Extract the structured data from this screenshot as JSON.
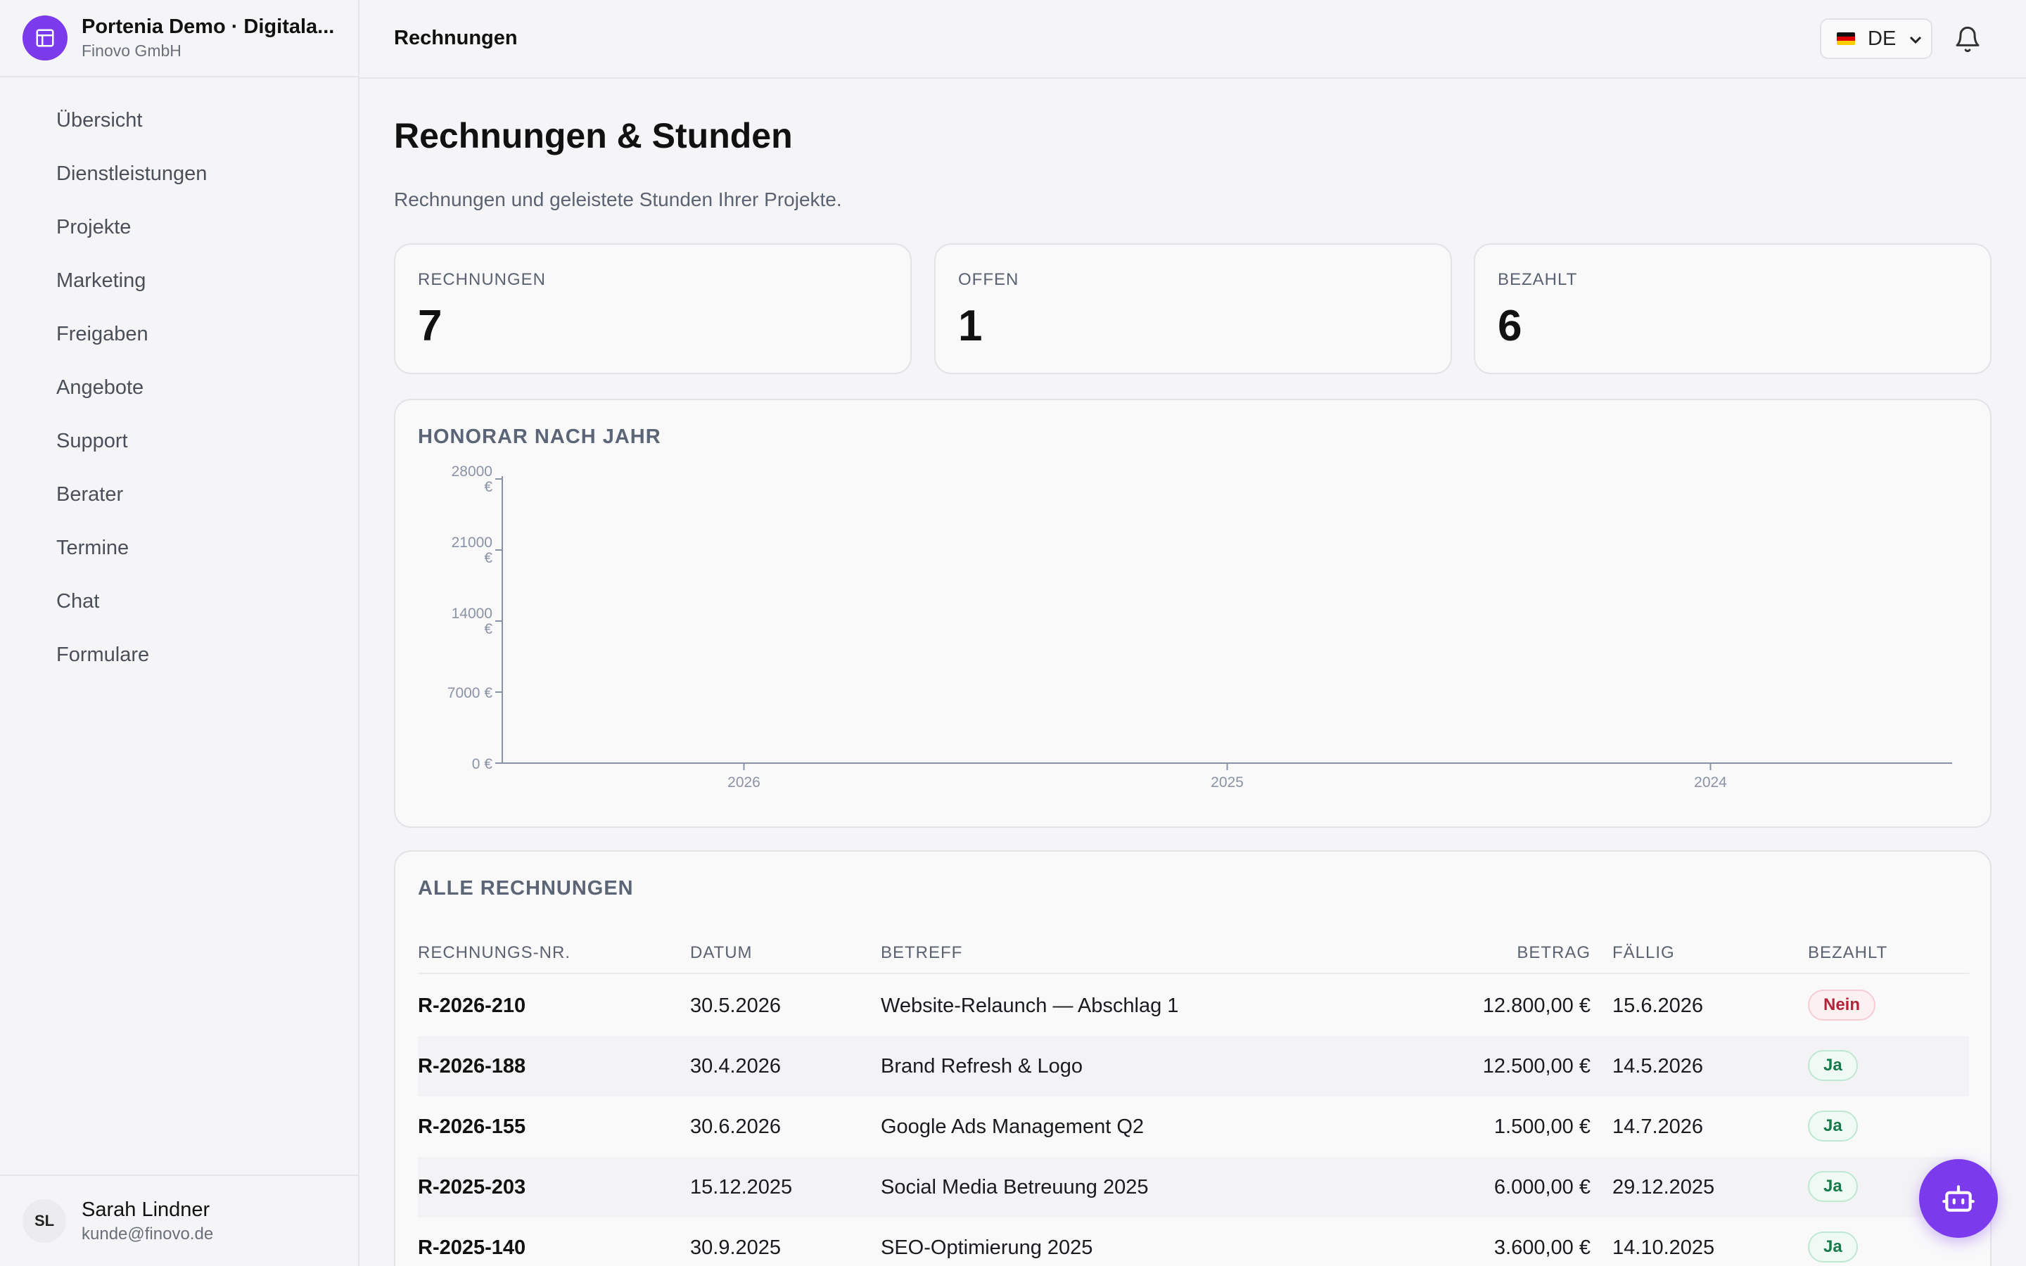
{
  "brand": {
    "title": "Portenia Demo · Digitala...",
    "company": "Finovo GmbH"
  },
  "sidebar": {
    "items": [
      {
        "label": "Übersicht"
      },
      {
        "label": "Dienstleistungen"
      },
      {
        "label": "Projekte"
      },
      {
        "label": "Marketing"
      },
      {
        "label": "Freigaben"
      },
      {
        "label": "Angebote"
      },
      {
        "label": "Support"
      },
      {
        "label": "Berater"
      },
      {
        "label": "Termine"
      },
      {
        "label": "Chat"
      },
      {
        "label": "Formulare"
      }
    ]
  },
  "user": {
    "initials": "SL",
    "name": "Sarah Lindner",
    "email": "kunde@finovo.de"
  },
  "topbar": {
    "title": "Rechnungen",
    "language": "DE"
  },
  "page": {
    "title": "Rechnungen & Stunden",
    "subtitle": "Rechnungen und geleistete Stunden Ihrer Projekte."
  },
  "stats": [
    {
      "label": "RECHNUNGEN",
      "value": "7"
    },
    {
      "label": "OFFEN",
      "value": "1"
    },
    {
      "label": "BEZAHLT",
      "value": "6"
    }
  ],
  "chart_title": "HONORAR NACH JAHR",
  "chart_data": {
    "type": "bar",
    "title": "HONORAR NACH JAHR",
    "categories": [
      "2026",
      "2025",
      "2024"
    ],
    "values": [
      0,
      0,
      0
    ],
    "yticks": [
      "0 €",
      "7000 €",
      "14000 €",
      "21000 €",
      "28000 €"
    ],
    "ylim": [
      0,
      28000
    ],
    "grid": false
  },
  "table": {
    "title": "ALLE RECHNUNGEN",
    "headers": {
      "nr": "RECHNUNGS-NR.",
      "date": "DATUM",
      "subject": "BETREFF",
      "amount": "BETRAG",
      "due": "FÄLLIG",
      "paid": "BEZAHLT"
    },
    "rows": [
      {
        "nr": "R-2026-210",
        "date": "30.5.2026",
        "subject": "Website-Relaunch — Abschlag 1",
        "amount": "12.800,00 €",
        "due": "15.6.2026",
        "paid": "Nein"
      },
      {
        "nr": "R-2026-188",
        "date": "30.4.2026",
        "subject": "Brand Refresh & Logo",
        "amount": "12.500,00 €",
        "due": "14.5.2026",
        "paid": "Ja"
      },
      {
        "nr": "R-2026-155",
        "date": "30.6.2026",
        "subject": "Google Ads Management Q2",
        "amount": "1.500,00 €",
        "due": "14.7.2026",
        "paid": "Ja"
      },
      {
        "nr": "R-2025-203",
        "date": "15.12.2025",
        "subject": "Social Media Betreuung 2025",
        "amount": "6.000,00 €",
        "due": "29.12.2025",
        "paid": "Ja"
      },
      {
        "nr": "R-2025-140",
        "date": "30.9.2025",
        "subject": "SEO-Optimierung 2025",
        "amount": "3.600,00 €",
        "due": "14.10.2025",
        "paid": "Ja"
      }
    ]
  },
  "colors": {
    "accent": "#7c3aed",
    "paid_yes": "#177a4b",
    "paid_no": "#b4233a"
  }
}
